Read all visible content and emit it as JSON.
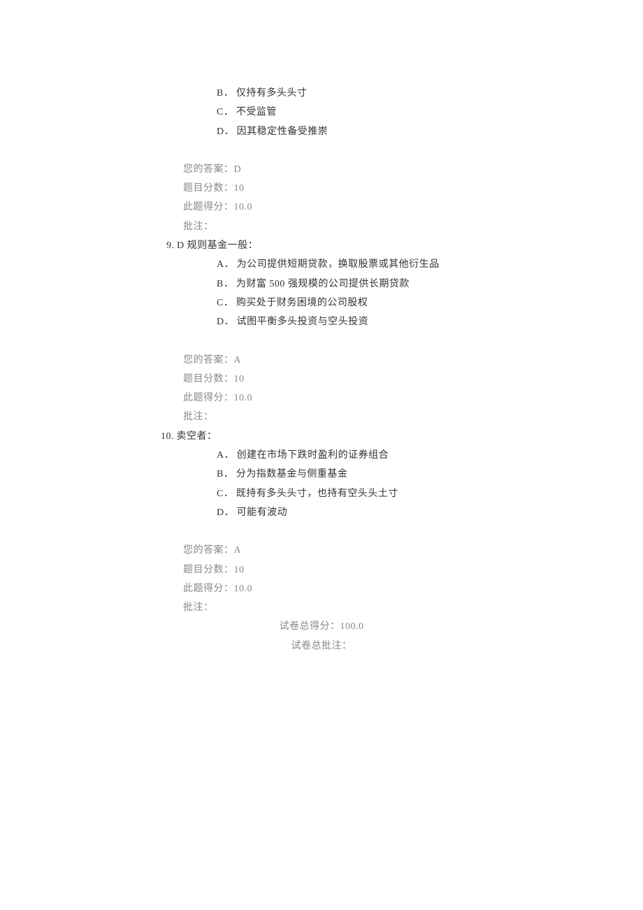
{
  "q8": {
    "options": {
      "b_letter": "B．",
      "b_text": "仅持有多头头寸",
      "c_letter": "C．",
      "c_text": "不受监管",
      "d_letter": "D．",
      "d_text": "因其稳定性备受推崇"
    },
    "your_answer_label": "您的答案：",
    "your_answer_value": "D",
    "score_label": "题目分数：",
    "score_value": "10",
    "earned_label": "此题得分：",
    "earned_value": "10.0",
    "remark_label": "批注："
  },
  "q9": {
    "number": "9.",
    "stem": "D 规则基金一般：",
    "options": {
      "a_letter": "A．",
      "a_text": "为公司提供短期贷款，换取股票或其他衍生品",
      "b_letter": "B．",
      "b_text": "为财富 500 强规模的公司提供长期贷款",
      "c_letter": "C．",
      "c_text": "购买处于财务困境的公司股权",
      "d_letter": "D．",
      "d_text": "试图平衡多头投资与空头投资"
    },
    "your_answer_label": "您的答案：",
    "your_answer_value": "A",
    "score_label": "题目分数：",
    "score_value": "10",
    "earned_label": "此题得分：",
    "earned_value": "10.0",
    "remark_label": "批注："
  },
  "q10": {
    "number": "10.",
    "stem": "卖空者：",
    "options": {
      "a_letter": "A．",
      "a_text": "创建在市场下跌时盈利的证券组合",
      "b_letter": "B．",
      "b_text": "分为指数基金与侧重基金",
      "c_letter": "C．",
      "c_text": "既持有多头头寸，也持有空头头土寸",
      "d_letter": "D．",
      "d_text": "可能有波动"
    },
    "your_answer_label": "您的答案：",
    "your_answer_value": "A",
    "score_label": "题目分数：",
    "score_value": "10",
    "earned_label": "此题得分：",
    "earned_value": "10.0",
    "remark_label": "批注："
  },
  "summary": {
    "total_label": "试卷总得分：",
    "total_value": "100.0",
    "remark_label": "试卷总批注："
  }
}
